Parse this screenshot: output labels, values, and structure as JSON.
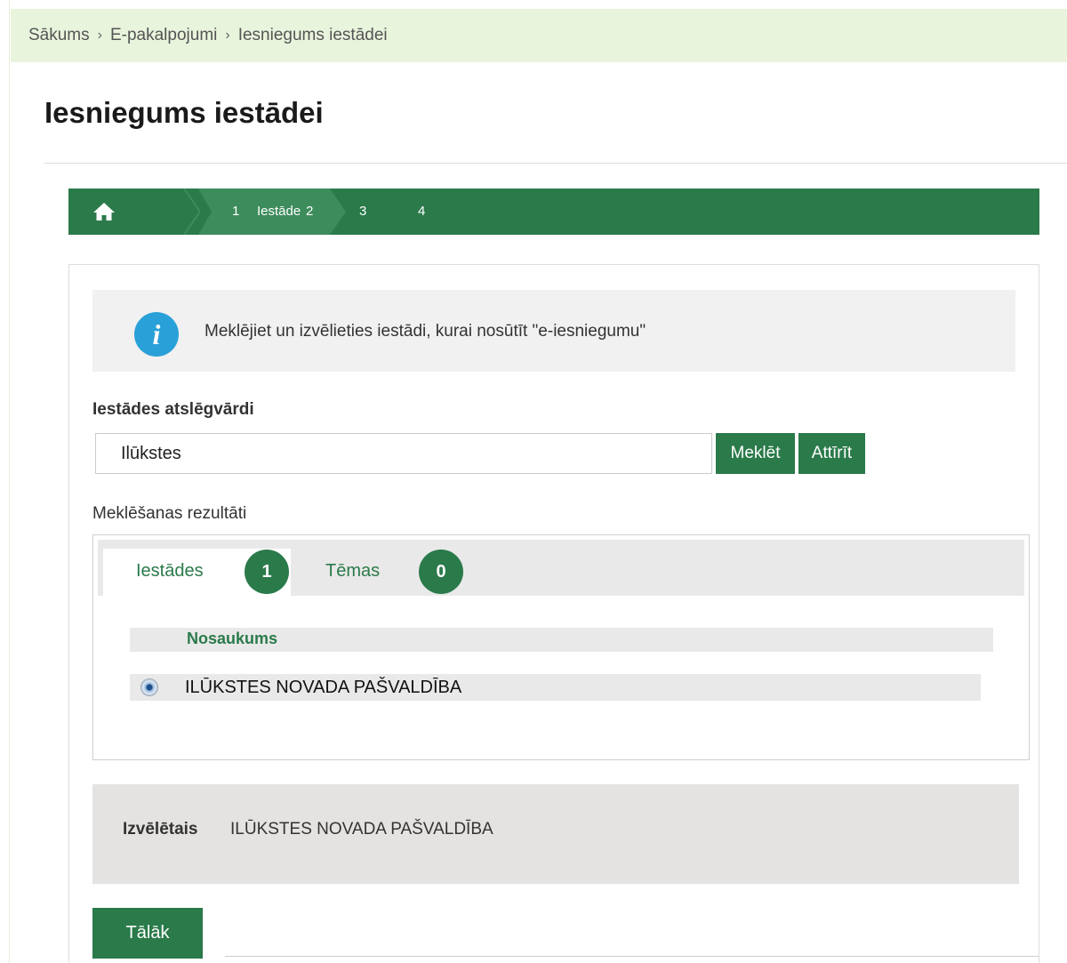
{
  "breadcrumb": {
    "items": [
      "Sākums",
      "E-pakalpojumi",
      "Iesniegums iestādei"
    ],
    "separator": "›"
  },
  "page": {
    "title": "Iesniegums iestādei"
  },
  "steps": {
    "home_icon": "home-icon",
    "active": {
      "number": "1",
      "label": "Iestāde"
    },
    "others": [
      "2",
      "3",
      "4"
    ]
  },
  "info": {
    "icon": "info-icon",
    "icon_glyph": "i",
    "text": "Meklējiet un izvēlieties iestādi, kurai nosūtīt \"e-iesniegumu\""
  },
  "search": {
    "label": "Iestādes atslēgvārdi",
    "value": "Ilūkstes",
    "search_button": "Meklēt",
    "clear_button": "Attīrīt"
  },
  "results": {
    "label": "Meklēšanas rezultāti",
    "tabs": [
      {
        "label": "Iestādes",
        "count": "1",
        "active": true
      },
      {
        "label": "Tēmas",
        "count": "0",
        "active": false
      }
    ],
    "column_header": "Nosaukums",
    "rows": [
      {
        "name": "ILŪKSTES NOVADA PAŠVALDĪBA",
        "selected": true
      }
    ]
  },
  "selected": {
    "label": "Izvēlētais",
    "value": "ILŪKSTES NOVADA PAŠVALDĪBA"
  },
  "actions": {
    "next_button": "Tālāk"
  },
  "colors": {
    "brand_green": "#2a7a4a",
    "active_step": "#3d8c5c",
    "breadcrumb_bg": "#e9f4dc",
    "info_blue": "#2aa0d8"
  }
}
